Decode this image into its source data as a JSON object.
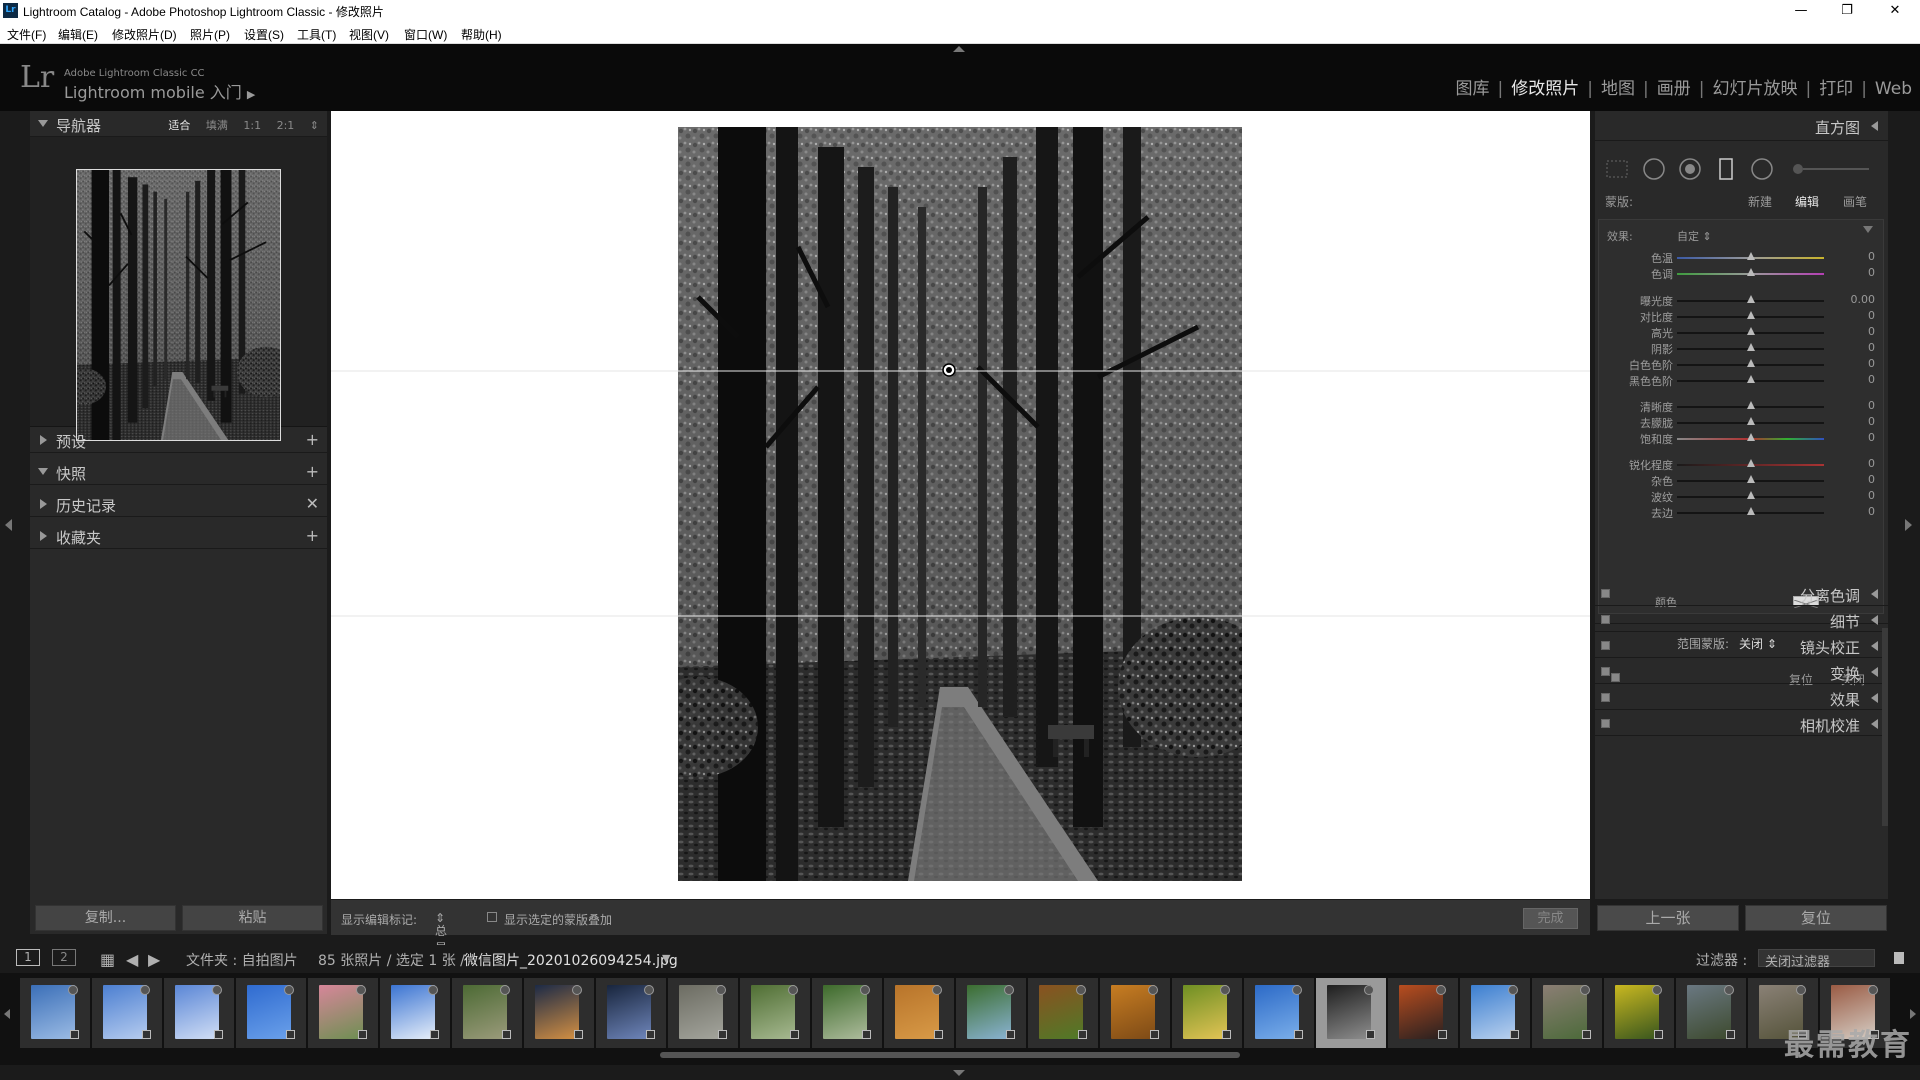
{
  "window": {
    "title": "Lightroom Catalog - Adobe Photoshop Lightroom Classic - 修改照片",
    "app_icon": "Lr",
    "controls": [
      "—",
      "❐",
      "✕"
    ]
  },
  "menu": [
    "文件(F)",
    "编辑(E)",
    "修改照片(D)",
    "照片(P)",
    "设置(S)",
    "工具(T)",
    "视图(V)",
    "窗口(W)",
    "帮助(H)"
  ],
  "identity": {
    "logo": "Lr",
    "product": "Adobe Lightroom Classic CC",
    "mobile": "Lightroom mobile 入门",
    "arrow": "▶"
  },
  "modules": [
    "图库",
    "修改照片",
    "地图",
    "画册",
    "幻灯片放映",
    "打印",
    "Web"
  ],
  "active_module": "修改照片",
  "left_panel": {
    "navigator": {
      "label": "导航器",
      "zoom": [
        "适合",
        "填满",
        "1:1",
        "2:1"
      ]
    },
    "sections": [
      {
        "label": "预设",
        "action": "+"
      },
      {
        "label": "快照",
        "action": "+"
      },
      {
        "label": "历史记录",
        "action": "✕"
      },
      {
        "label": "收藏夹",
        "action": "+"
      }
    ],
    "copy_label": "复制...",
    "paste_label": "粘贴"
  },
  "toolbar": {
    "show_pins_label": "显示编辑标记:",
    "show_pins_value": "总是",
    "overlay_label": "显示选定的蒙版叠加",
    "done_label": "完成"
  },
  "right_panel": {
    "histogram_label": "直方图",
    "mask": {
      "label": "蒙版:",
      "new": "新建",
      "edit": "编辑",
      "brush": "画笔"
    },
    "effect_label": "效果:",
    "effect_value": "自定",
    "sliders": [
      {
        "name": "色温",
        "value": "0",
        "gradient": "temp"
      },
      {
        "name": "色调",
        "value": "0",
        "gradient": "tint"
      },
      {
        "name": "曝光度",
        "value": "0.00",
        "gradient": "none"
      },
      {
        "name": "对比度",
        "value": "0",
        "gradient": "none"
      },
      {
        "name": "高光",
        "value": "0",
        "gradient": "none"
      },
      {
        "name": "阴影",
        "value": "0",
        "gradient": "none"
      },
      {
        "name": "白色色阶",
        "value": "0",
        "gradient": "none"
      },
      {
        "name": "黑色色阶",
        "value": "0",
        "gradient": "none"
      },
      {
        "name": "清晰度",
        "value": "0",
        "gradient": "none"
      },
      {
        "name": "去朦胧",
        "value": "0",
        "gradient": "none"
      },
      {
        "name": "饱和度",
        "value": "0",
        "gradient": "sat"
      },
      {
        "name": "锐化程度",
        "value": "0",
        "gradient": "sharp"
      },
      {
        "name": "杂色",
        "value": "0",
        "gradient": "none"
      },
      {
        "name": "波纹",
        "value": "0",
        "gradient": "none"
      },
      {
        "name": "去边",
        "value": "0",
        "gradient": "none"
      }
    ],
    "color_label": "颜色",
    "range_mask_label": "范围蒙版:",
    "range_mask_value": "关闭",
    "reset_label": "复位",
    "close_label": "关闭",
    "panels": [
      "分离色调",
      "细节",
      "镜头校正",
      "变换",
      "效果",
      "相机校准"
    ],
    "prev_label": "上一张",
    "reset_all_label": "复位"
  },
  "filmstrip_bar": {
    "page1": "1",
    "page2": "2",
    "source": "文件夹 : 自拍图片",
    "count": "85 张照片 / 选定 1 张 /",
    "filename": "微信图片_20201026094254.jpg",
    "filter_label": "过滤器 :",
    "filter_value": "关闭过滤器"
  },
  "filmstrip": [
    {
      "colors": [
        "#3b6fb8",
        "#9bbbe4"
      ]
    },
    {
      "colors": [
        "#4c7fd1",
        "#b6ccef"
      ]
    },
    {
      "colors": [
        "#5a86d6",
        "#d1def5"
      ]
    },
    {
      "colors": [
        "#2f6bd0",
        "#6aa0ea"
      ]
    },
    {
      "colors": [
        "#d7869a",
        "#6e8f52"
      ]
    },
    {
      "colors": [
        "#3b74d2",
        "#e6eef9"
      ]
    },
    {
      "colors": [
        "#4c6a34",
        "#9b9b7b"
      ]
    },
    {
      "colors": [
        "#1c2a46",
        "#d49043"
      ]
    },
    {
      "colors": [
        "#18253d",
        "#6f86bb"
      ]
    },
    {
      "colors": [
        "#6c6c62",
        "#a4a59d"
      ]
    },
    {
      "colors": [
        "#4f6e33",
        "#a7b991"
      ]
    },
    {
      "colors": [
        "#3d6a2b",
        "#aebc9d"
      ]
    },
    {
      "colors": [
        "#b8742a",
        "#d89a47"
      ]
    },
    {
      "colors": [
        "#3b6d2f",
        "#8ab3d3"
      ]
    },
    {
      "colors": [
        "#8a5120",
        "#4f7a28"
      ]
    },
    {
      "colors": [
        "#c77d22",
        "#7d4a16"
      ]
    },
    {
      "colors": [
        "#6e8f23",
        "#e3c455"
      ]
    },
    {
      "colors": [
        "#2c6ac7",
        "#7aaeea"
      ]
    },
    {
      "colors": [
        "#1e1e1e",
        "#8e8e8e"
      ]
    },
    {
      "colors": [
        "#b84d1f",
        "#282020"
      ]
    },
    {
      "colors": [
        "#3b7ed0",
        "#bad1ee"
      ]
    },
    {
      "colors": [
        "#8b7e74",
        "#4c6a3a"
      ]
    },
    {
      "colors": [
        "#c9b820",
        "#39561e"
      ]
    },
    {
      "colors": [
        "#6a7882",
        "#3d4a2e"
      ]
    },
    {
      "colors": [
        "#8a8176",
        "#55533a"
      ]
    },
    {
      "colors": [
        "#9a5b44",
        "#d5cdc4"
      ]
    }
  ],
  "selected_thumb": 18,
  "watermark": "最需教育",
  "colors": {
    "panel_bg": "#292929",
    "dark_bg": "#1b1b1b",
    "canvas": "#ffffff",
    "active_text": "#e8e8e8"
  }
}
